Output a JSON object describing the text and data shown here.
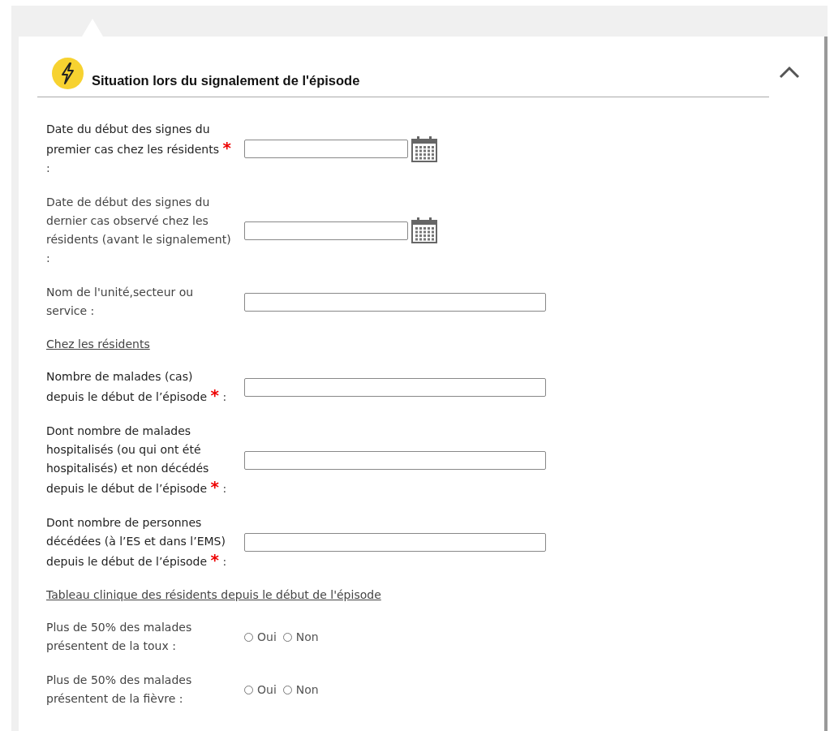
{
  "section": {
    "title": "Situation lors du signalement de l'épisode",
    "expanded": true
  },
  "fields": [
    {
      "kind": "date",
      "label": "Date du début des signes du premier cas chez les résidents",
      "required_mark": "*",
      "suffix": ":"
    },
    {
      "kind": "date",
      "label": "Date de début des signes du dernier cas observé chez les résidents (avant le signalement) :"
    },
    {
      "kind": "text",
      "label": "Nom de l'unité,secteur ou service :"
    },
    {
      "kind": "heading",
      "label": "Chez les résidents"
    },
    {
      "kind": "text",
      "label": "Nombre de malades (cas) depuis le début de l’épisode",
      "required_mark": "*",
      "suffix": ":"
    },
    {
      "kind": "text",
      "label": "Dont nombre de malades hospitalisés (ou qui ont été hospitalisés) et non décédés depuis le début de l’épisode",
      "required_mark": "*",
      "suffix": ":"
    },
    {
      "kind": "text",
      "label": "Dont nombre de personnes décédées (à l’ES et dans l’EMS) depuis le début de l’épisode",
      "required_mark": "*",
      "suffix": ":"
    },
    {
      "kind": "heading",
      "label": "Tableau clinique des résidents depuis le début de l'épisode"
    },
    {
      "kind": "radio",
      "label": "Plus de 50% des malades présentent de la toux :",
      "options": [
        {
          "label": "Oui",
          "selected": false
        },
        {
          "label": "Non",
          "selected": false
        }
      ]
    },
    {
      "kind": "radio",
      "label": "Plus de 50% des malades présentent de la fièvre :",
      "options": [
        {
          "label": "Oui",
          "selected": false
        },
        {
          "label": "Non",
          "selected": false
        }
      ]
    }
  ]
}
